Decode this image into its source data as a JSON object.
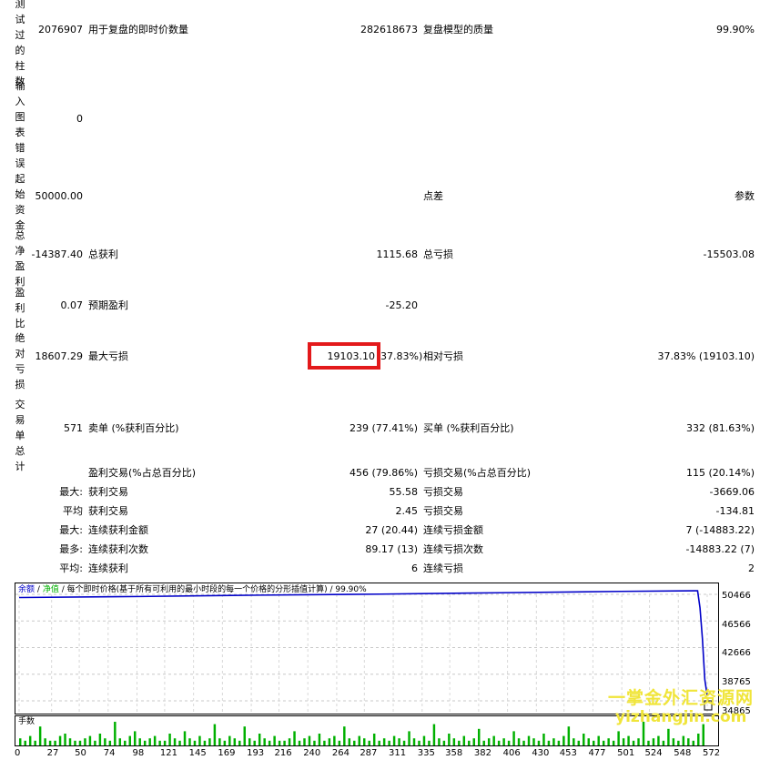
{
  "side_labels": {
    "bars_tested": "测试过的柱数",
    "input_errors": "输入图表错误",
    "initial_deposit": "起始资金",
    "total_net_profit": "总净盈利",
    "profit_factor": "盈利比",
    "absolute_drawdown": "绝对亏损",
    "total_trades": "交易单总计"
  },
  "rows": {
    "bars": {
      "value": "2076907",
      "label": "用于复盘的即时价数量",
      "value2": "282618673",
      "label2": "复盘模型的质量",
      "value3": "99.90%"
    },
    "errors": {
      "value": "0"
    },
    "deposit": {
      "value": "50000.00",
      "label2": "点差",
      "value3": "参数"
    },
    "net_profit": {
      "value": "-14387.40",
      "label": "总获利",
      "value2": "1115.68",
      "label2": "总亏损",
      "value3": "-15503.08"
    },
    "profit_factor": {
      "value": "0.07",
      "label": "预期盈利",
      "value2": "-25.20"
    },
    "drawdown": {
      "value": "18607.29",
      "label": "最大亏损",
      "value2_highlight": "19103.10",
      "value2_rest": "37.83%)",
      "label2": "相对亏损",
      "value3": "37.83% (19103.10)"
    },
    "trades": {
      "value": "571",
      "label": "卖单 (%获利百分比)",
      "value2": "239 (77.41%)",
      "label2": "买单 (%获利百分比)",
      "value3": "332 (81.63%)"
    },
    "profit_trades": {
      "label": "盈利交易(%占总百分比)",
      "value2": "456 (79.86%)",
      "label2": "亏损交易(%占总百分比)",
      "value3": "115 (20.14%)"
    },
    "largest": {
      "prefix": "最大:",
      "label": "获利交易",
      "value2": "55.58",
      "label2": "亏损交易",
      "value3": "-3669.06"
    },
    "average": {
      "prefix": "平均",
      "label": "获利交易",
      "value2": "2.45",
      "label2": "亏损交易",
      "value3": "-134.81"
    },
    "max_consec_money": {
      "prefix": "最大:",
      "label": "连续获利金额",
      "value2": "27 (20.44)",
      "label2": "连续亏损金额",
      "value3": "7 (-14883.22)"
    },
    "max_consec_count": {
      "prefix": "最多:",
      "label": "连续获利次数",
      "value2": "89.17 (13)",
      "label2": "连续亏损次数",
      "value3": "-14883.22 (7)"
    },
    "avg_consec": {
      "prefix": "平均:",
      "label": "连续获利",
      "value2": "6",
      "label2": "连续亏损",
      "value3": "2"
    }
  },
  "chart": {
    "legend_balance": "余额",
    "legend_sep1": "/",
    "legend_equity": "净值",
    "legend_rest": "/ 每个即时价格(基于所有可利用的最小时段的每一个价格的分形插值计算) / 99.90%",
    "volume_label": "手数",
    "balance_color": "#0000c8",
    "equity_color": "#00b000",
    "volume_color": "#00b000"
  },
  "chart_data": {
    "type": "line",
    "y_ticks": [
      "50466",
      "46566",
      "42666",
      "38765",
      "34865"
    ],
    "x_ticks": [
      "0",
      "27",
      "50",
      "74",
      "98",
      "121",
      "145",
      "169",
      "193",
      "216",
      "240",
      "264",
      "287",
      "311",
      "335",
      "358",
      "382",
      "406",
      "430",
      "453",
      "477",
      "501",
      "524",
      "548",
      "572"
    ],
    "ylim": [
      34865,
      50466
    ],
    "xlim": [
      0,
      572
    ],
    "series": [
      {
        "name": "余额",
        "x": [
          0,
          100,
          200,
          300,
          400,
          500,
          564,
          566,
          568,
          570,
          572
        ],
        "values": [
          50000,
          50150,
          50350,
          50500,
          50700,
          50900,
          51000,
          48500,
          44000,
          38000,
          35610
        ]
      }
    ],
    "volume": [
      3,
      2,
      4,
      2,
      8,
      3,
      2,
      2,
      4,
      5,
      3,
      2,
      2,
      3,
      4,
      2,
      5,
      3,
      2,
      10,
      3,
      2,
      4,
      6,
      3,
      2,
      3,
      4,
      2,
      2,
      5,
      3,
      2,
      6,
      3,
      2,
      4,
      2,
      3,
      9,
      3,
      2,
      4,
      3,
      2,
      8,
      3,
      2,
      5,
      3,
      2,
      4,
      2,
      2,
      3,
      6,
      2,
      3,
      4,
      2,
      5,
      2,
      3,
      4,
      2,
      8,
      3,
      2,
      4,
      3,
      2,
      5,
      2,
      3,
      2,
      4,
      3,
      2,
      6,
      3,
      2,
      4,
      2,
      9,
      3,
      2,
      5,
      3,
      2,
      4,
      2,
      3,
      7,
      2,
      3,
      4,
      2,
      3,
      2,
      6,
      3,
      2,
      4,
      3,
      2,
      5,
      2,
      3,
      2,
      4,
      8,
      3,
      2,
      5,
      3,
      2,
      4,
      2,
      3,
      2,
      6,
      3,
      4,
      2,
      3,
      10,
      2,
      3,
      4,
      2,
      7,
      3,
      2,
      4,
      3,
      2,
      5,
      9
    ]
  },
  "watermark": {
    "line1": "一掌金外汇资源网",
    "line2": "yizhangjin.com"
  }
}
